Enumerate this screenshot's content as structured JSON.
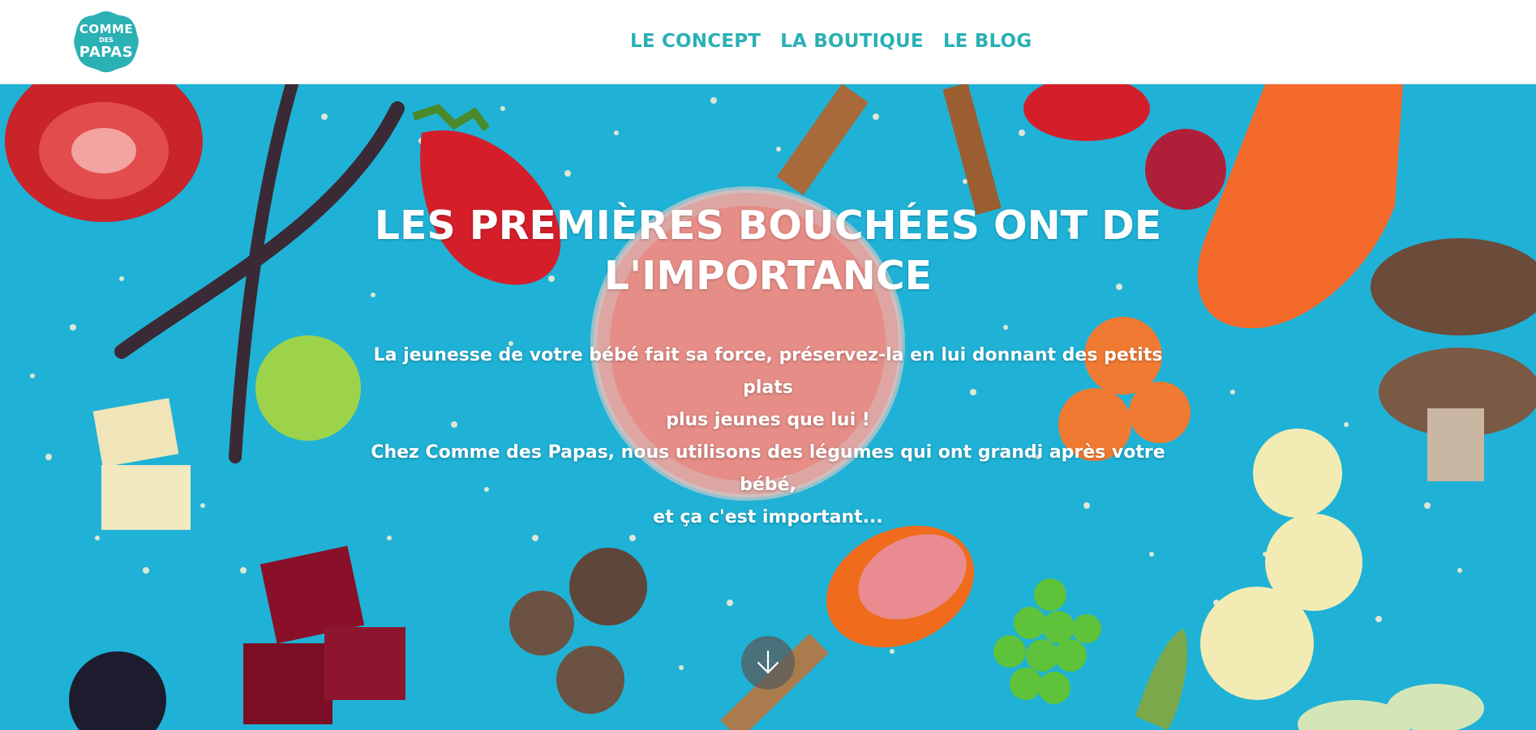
{
  "header": {
    "logo": {
      "line1": "COMME",
      "line2": "DES",
      "line3": "PAPAS"
    },
    "nav": [
      "LE CONCEPT",
      "LA BOUTIQUE",
      "LE BLOG"
    ]
  },
  "hero": {
    "title_line1": "LES PREMIÈRES BOUCHÉES ONT DE",
    "title_line2": "L'IMPORTANCE",
    "paragraph1_line1": "La jeunesse de votre bébé fait sa force, préservez-la en lui donnant des petits plats",
    "paragraph1_line2": "plus jeunes que lui !",
    "paragraph2_line1": "Chez Comme des Papas, nous utilisons des légumes qui ont grandi après votre bébé,",
    "paragraph2_line2": "et ça c'est important...",
    "scroll_icon": "arrow-down-icon"
  },
  "colors": {
    "brand": "#2bb0b4",
    "hero_background": "#1fb2d6"
  }
}
